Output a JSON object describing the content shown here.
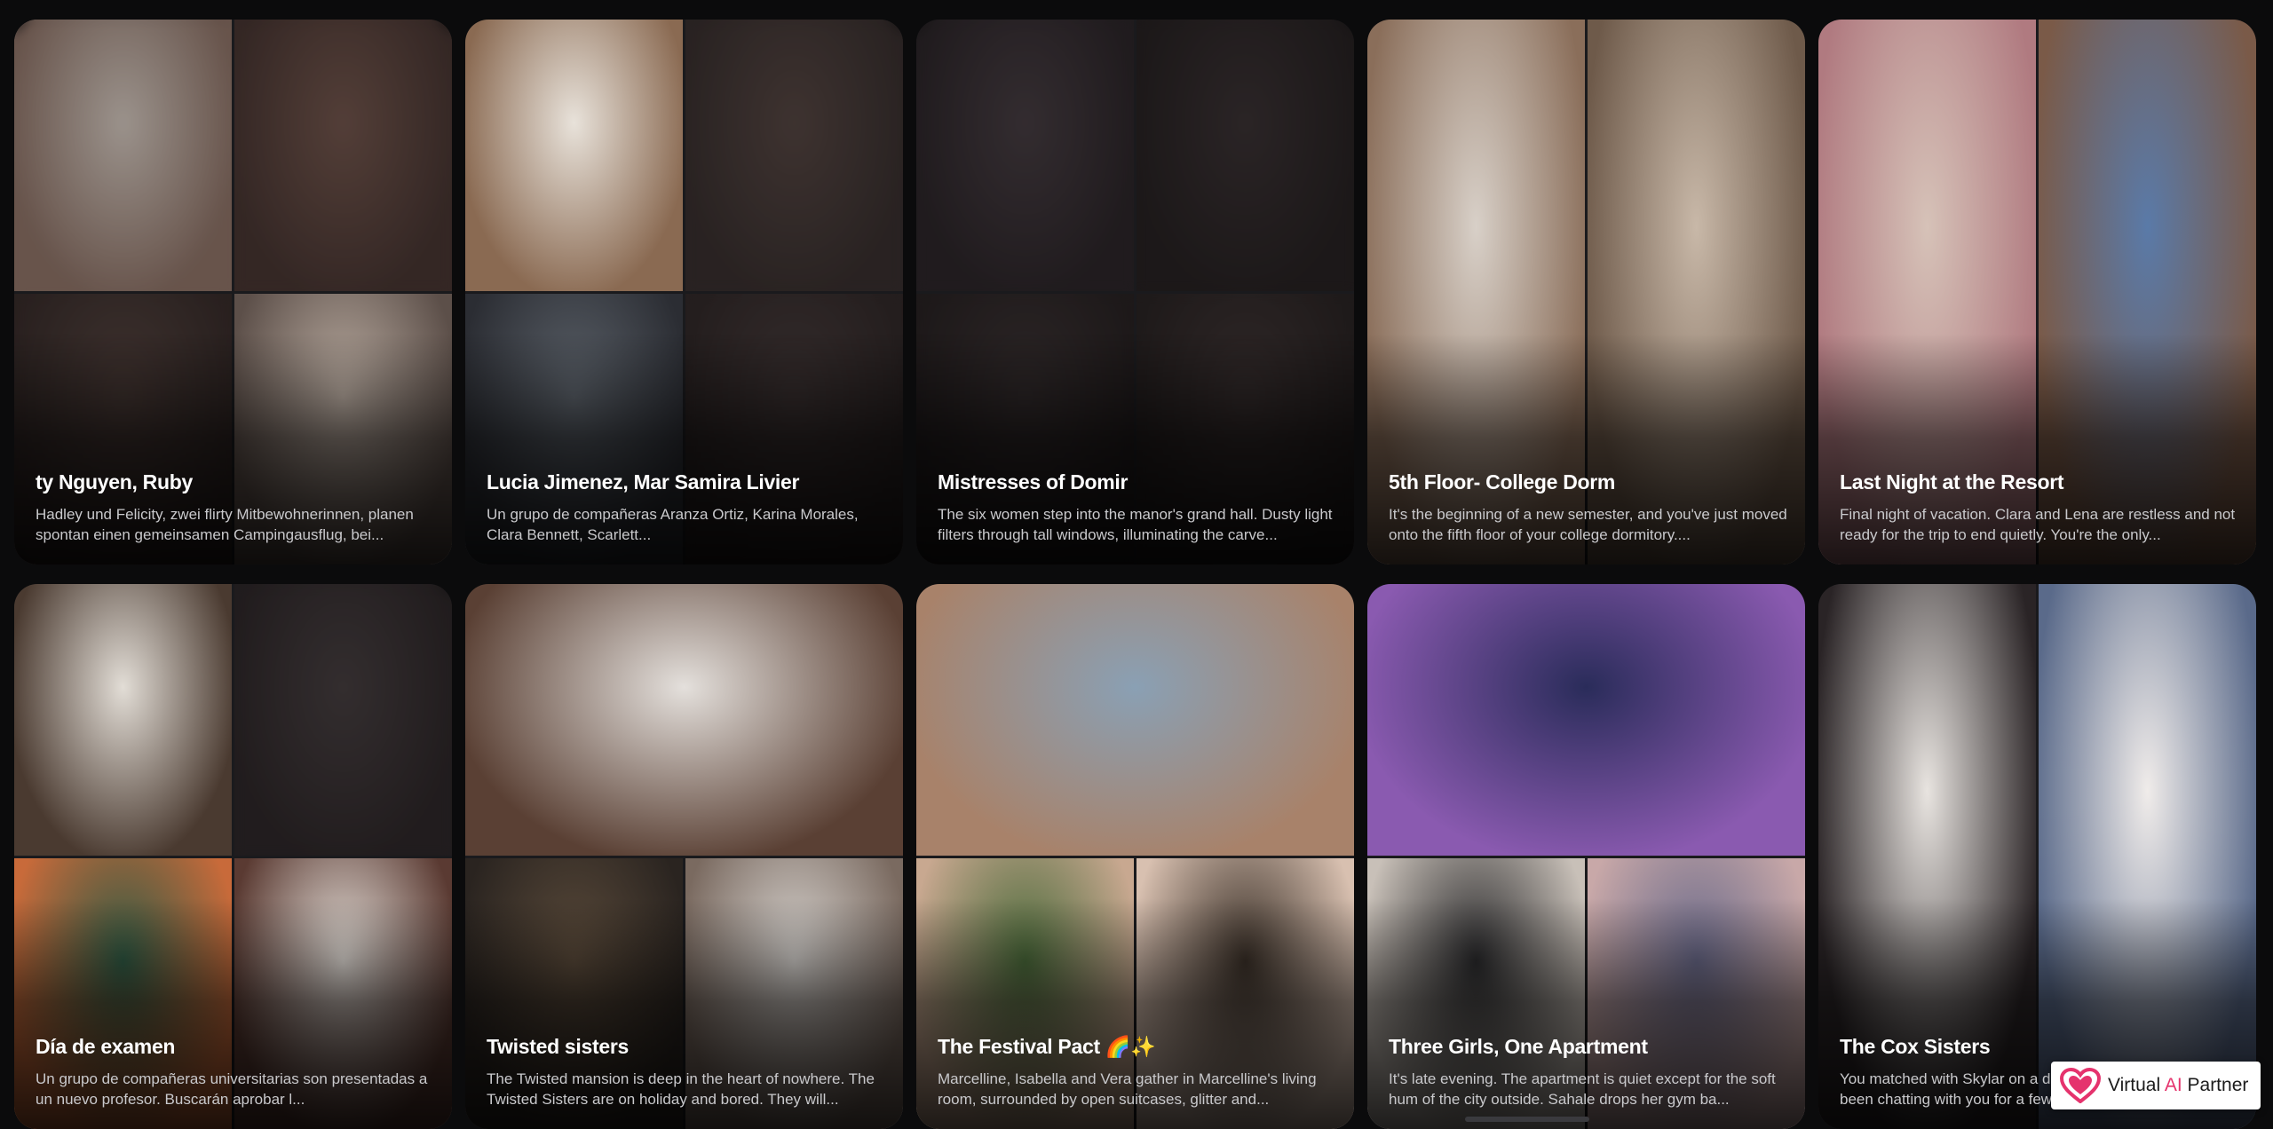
{
  "colors": {
    "background": "#0b0b0c",
    "title_text": "#ffffff",
    "description_text": "#c9c9cc",
    "brand_heart": "#e5336d"
  },
  "brand": {
    "name_part1": "Virtual ",
    "name_part2": "AI",
    "name_part3": " Partner",
    "icon": "heart-logo-icon"
  },
  "cards": [
    {
      "title": "ty Nguyen, Ruby",
      "description": "Hadley und Felicity, zwei flirty Mitbewohnerinnen, planen spontan einen gemeinsamen Campingausflug, bei...",
      "layout": "quad",
      "tiles": [
        {
          "c1": "#d9cfc5",
          "c2": "#8a6f62",
          "blurred": true
        },
        {
          "c1": "#6b4e44",
          "c2": "#3b2a26",
          "blurred": true
        },
        {
          "c1": "#4a3a35",
          "c2": "#2a201e",
          "blurred": true
        },
        {
          "c1": "#b9aba0",
          "c2": "#5c4f49",
          "blurred": false
        }
      ]
    },
    {
      "title": "Lucia Jimenez, Mar Samira Livier",
      "description": "Un grupo de compañeras Aranza Ortiz, Karina Morales, Clara Bennett, Scarlett...",
      "layout": "quad",
      "tiles": [
        {
          "c1": "#e8e2da",
          "c2": "#8a6a52",
          "blurred": false
        },
        {
          "c1": "#4a3c38",
          "c2": "#2a2322",
          "blurred": true
        },
        {
          "c1": "#5a6068",
          "c2": "#2b2d33",
          "blurred": false
        },
        {
          "c1": "#3a3030",
          "c2": "#221c1c",
          "blurred": true
        }
      ]
    },
    {
      "title": "Mistresses of Domir",
      "description": "The six women step into the manor's grand hall. Dusty light filters through tall windows, illuminating the carve...",
      "layout": "quad",
      "tiles": [
        {
          "c1": "#3a3238",
          "c2": "#1c181c",
          "blurred": true
        },
        {
          "c1": "#2c2628",
          "c2": "#161314",
          "blurred": true
        },
        {
          "c1": "#2e2829",
          "c2": "#181415",
          "blurred": true
        },
        {
          "c1": "#322a2a",
          "c2": "#1a1616",
          "blurred": true
        }
      ]
    },
    {
      "title": "5th Floor- College Dorm",
      "description": "It's the beginning of a new semester, and you've just moved onto the fifth floor of your college dormitory....",
      "layout": "half",
      "tiles": [
        {
          "c1": "#d8d0c8",
          "c2": "#8a6e5a",
          "blurred": false
        },
        {
          "c1": "#c8b8a8",
          "c2": "#6e5a4a",
          "blurred": false
        }
      ]
    },
    {
      "title": "Last Night at the Resort",
      "description": "Final night of vacation. Clara and Lena are restless and not ready for the trip to end quietly. You're the only...",
      "layout": "half",
      "tiles": [
        {
          "c1": "#d6c2b8",
          "c2": "#b07a80",
          "blurred": false
        },
        {
          "c1": "#5a7aa8",
          "c2": "#7a5a48",
          "blurred": false
        }
      ]
    },
    {
      "title": "Día de examen",
      "description": "Un grupo de compañeras universitarias son presentadas a un nuevo profesor. Buscarán aprobar l...",
      "layout": "quad",
      "tiles": [
        {
          "c1": "#e2ddd6",
          "c2": "#4a3a30",
          "blurred": false
        },
        {
          "c1": "#3a3436",
          "c2": "#1e1a1c",
          "blurred": true
        },
        {
          "c1": "#2f5a44",
          "c2": "#c86a3a",
          "blurred": false
        },
        {
          "c1": "#e6e0da",
          "c2": "#5a3a32",
          "blurred": false
        }
      ]
    },
    {
      "title": "Twisted sisters",
      "description": "The Twisted mansion is deep in the heart of nowhere. The Twisted Sisters are on holiday and bored. They will...",
      "layout": "top",
      "tiles": [
        {
          "c1": "#e4e0dc",
          "c2": "#5a4034",
          "blurred": false
        },
        {
          "c1": "#5a4a3a",
          "c2": "#2a2420",
          "blurred": false
        },
        {
          "c1": "#d8d4d0",
          "c2": "#7a6a60",
          "blurred": false
        }
      ]
    },
    {
      "title": "The Festival Pact 🌈✨",
      "description": "Marcelline, Isabella and Vera gather in Marcelline's living room, surrounded by open suitcases, glitter and...",
      "layout": "top",
      "tiles": [
        {
          "c1": "#8aa0b4",
          "c2": "#a8826a",
          "blurred": false
        },
        {
          "c1": "#4a6a3a",
          "c2": "#c8a890",
          "blurred": false
        },
        {
          "c1": "#3a3028",
          "c2": "#d8c0b0",
          "blurred": false
        }
      ]
    },
    {
      "title": "Three Girls, One Apartment",
      "description": "It's late evening. The apartment is quiet except for the soft hum of the city outside. Sahale drops her gym ba...",
      "layout": "top",
      "tiles": [
        {
          "c1": "#2a2c5a",
          "c2": "#8a5ab0",
          "blurred": false
        },
        {
          "c1": "#2a2a2c",
          "c2": "#c8c0b8",
          "blurred": false
        },
        {
          "c1": "#6a6a8a",
          "c2": "#c8a8a8",
          "blurred": false
        }
      ]
    },
    {
      "title": "The Cox Sisters",
      "description": "You matched with Skylar on a dating app, and she has been chatting with you for a few days of flirty messages s...",
      "layout": "half",
      "tiles": [
        {
          "c1": "#e8e4e0",
          "c2": "#2a2426",
          "blurred": false
        },
        {
          "c1": "#f0ecea",
          "c2": "#5a6a8a",
          "blurred": false
        }
      ]
    }
  ]
}
